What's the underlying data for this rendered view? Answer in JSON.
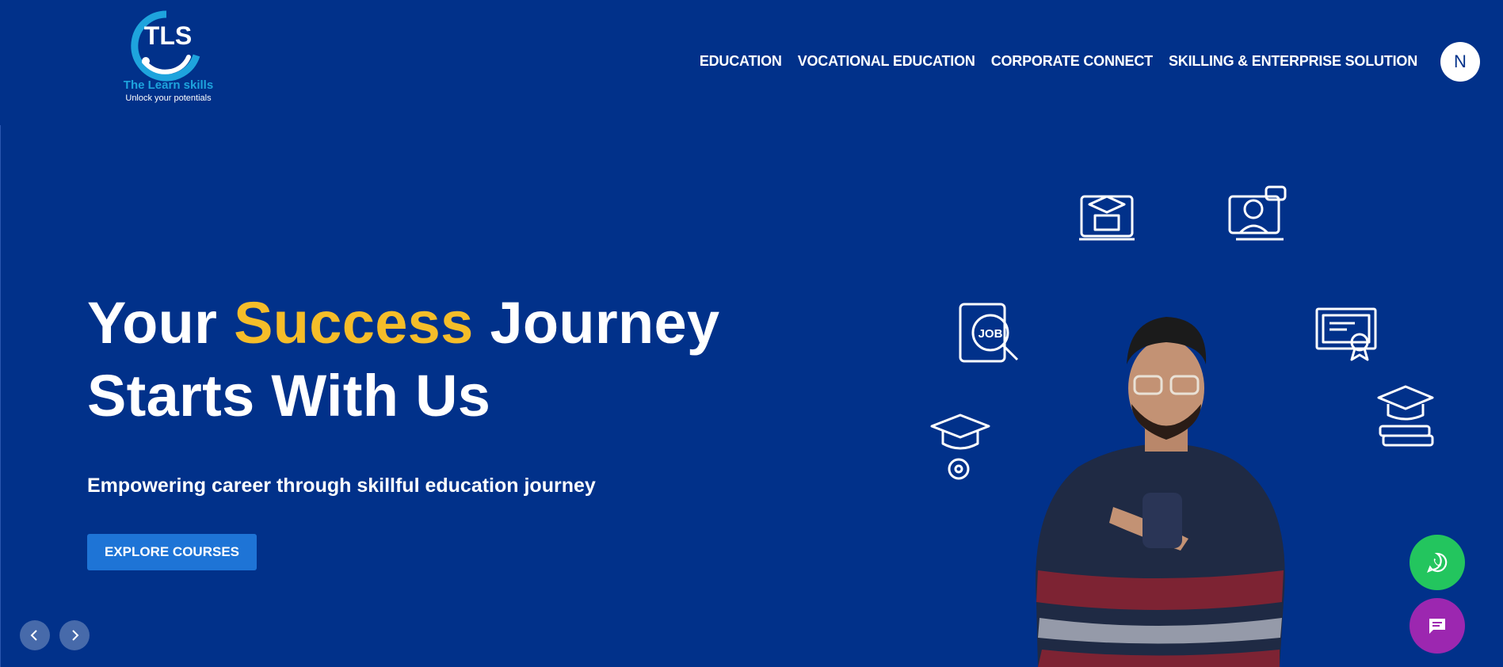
{
  "brand": {
    "mark": "TLS",
    "name": "The Learn skills",
    "tagline": "Unlock your potentials"
  },
  "nav": {
    "items": [
      {
        "label": "EDUCATION"
      },
      {
        "label": "VOCATIONAL EDUCATION"
      },
      {
        "label": "CORPORATE CONNECT"
      },
      {
        "label": "SKILLING & ENTERPRISE SOLUTION"
      }
    ],
    "avatar_initial": "N"
  },
  "hero": {
    "title_part1": "Your ",
    "title_accent": "Success",
    "title_part2": " Journey",
    "title_line2": "Starts With Us",
    "subtitle": "Empowering career through skillful education journey",
    "cta_label": "EXPLORE COURSES",
    "icon_job_label": "JOB"
  },
  "carousel": {
    "prev_icon": "chevron-left-icon",
    "next_icon": "chevron-right-icon"
  },
  "floating": {
    "whatsapp_icon": "whatsapp-icon",
    "chat_icon": "chat-icon"
  },
  "colors": {
    "background": "#01318a",
    "accent_yellow": "#f5bd29",
    "button_blue": "#1e74d6",
    "whatsapp_green": "#23c55e",
    "chat_purple": "#9c27b0",
    "logo_cyan": "#1ea4dd"
  }
}
